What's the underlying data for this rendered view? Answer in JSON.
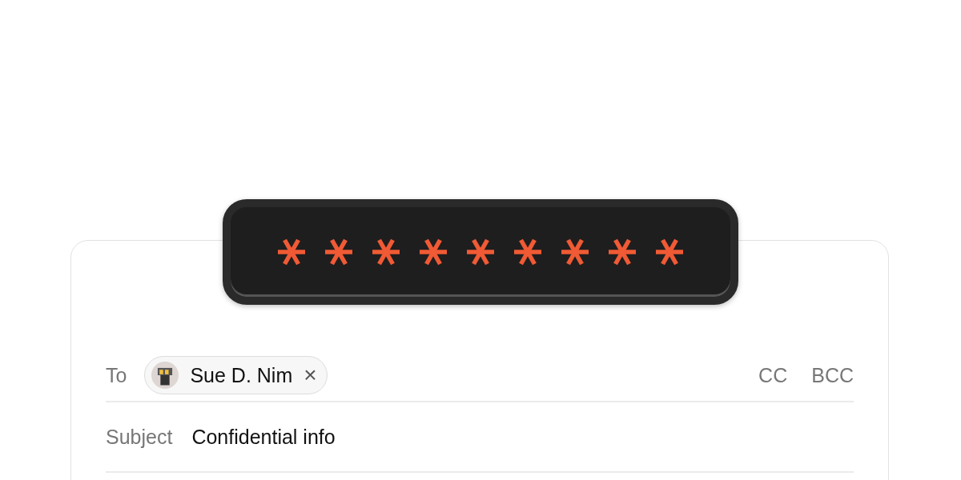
{
  "mask": [
    {
      "kind": "asterisk"
    },
    {
      "kind": "asterisk"
    },
    {
      "kind": "asterisk"
    },
    {
      "kind": "asterisk"
    },
    {
      "kind": "asterisk"
    },
    {
      "kind": "asterisk"
    },
    {
      "kind": "asterisk"
    },
    {
      "kind": "asterisk"
    },
    {
      "kind": "asterisk"
    }
  ],
  "to": {
    "label": "To",
    "recipients": [
      {
        "name": "Sue D. Nim",
        "remove": "×"
      }
    ],
    "cc": "CC",
    "bcc": "BCC"
  },
  "subject": {
    "label": "Subject",
    "value": "Confidential info"
  }
}
